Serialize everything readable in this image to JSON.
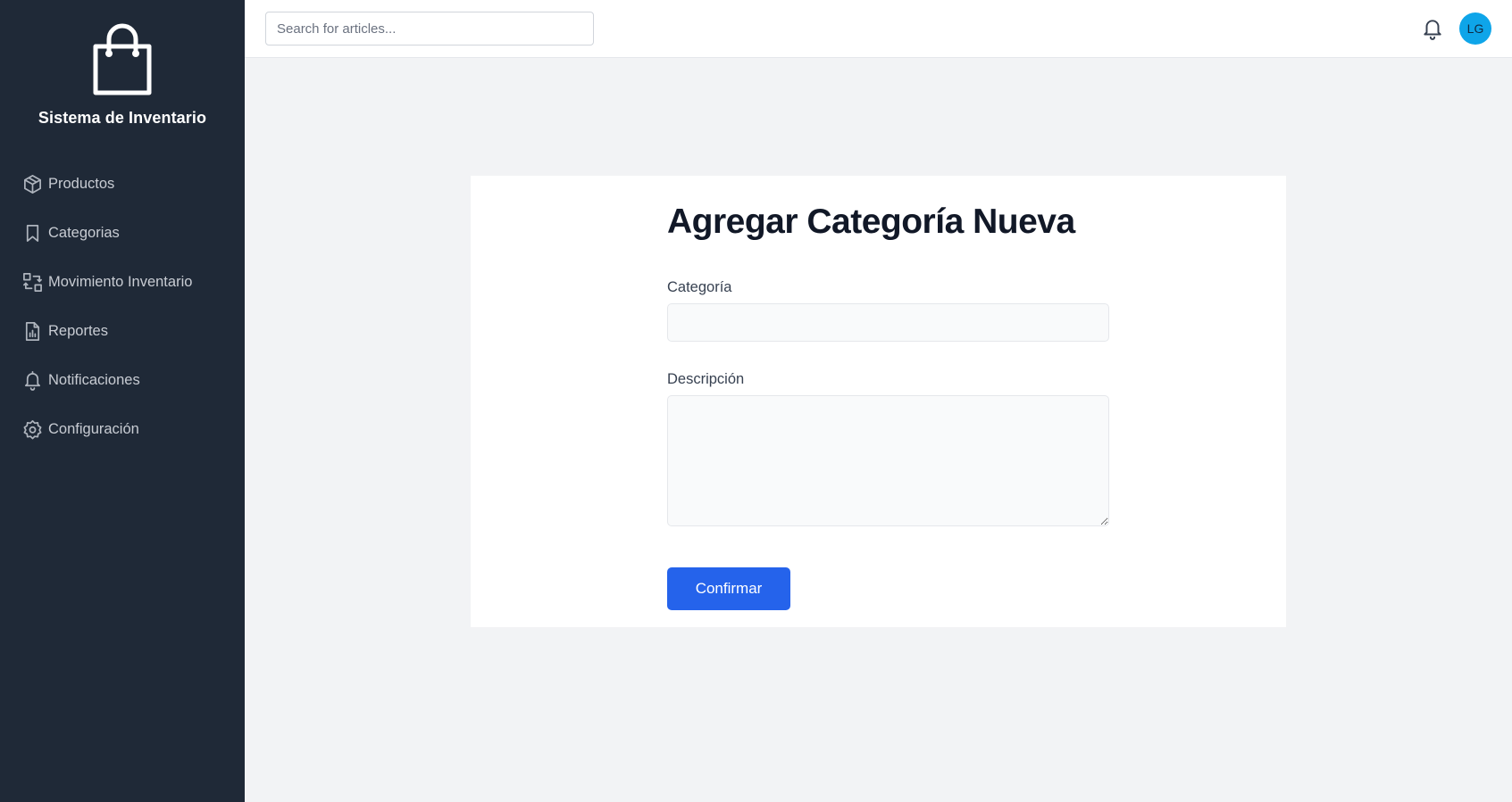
{
  "sidebar": {
    "brand_title": "Sistema de Inventario",
    "brand_icon": "shopping-bag-icon",
    "items": [
      {
        "label": "Productos",
        "icon": "cube-icon"
      },
      {
        "label": "Categorias",
        "icon": "bookmark-icon"
      },
      {
        "label": "Movimiento Inventario",
        "icon": "transfer-icon"
      },
      {
        "label": "Reportes",
        "icon": "report-icon"
      },
      {
        "label": "Notificaciones",
        "icon": "bell-icon"
      },
      {
        "label": "Configuración",
        "icon": "gear-icon"
      }
    ]
  },
  "topbar": {
    "search_placeholder": "Search for articles...",
    "avatar_initials": "LG"
  },
  "form": {
    "title": "Agregar Categoría Nueva",
    "categoria_label": "Categoría",
    "descripcion_label": "Descripción",
    "submit_label": "Confirmar"
  },
  "colors": {
    "sidebar_bg": "#1f2937",
    "accent": "#2563eb",
    "avatar_bg": "#0ea5e9",
    "page_bg": "#f2f3f5"
  }
}
